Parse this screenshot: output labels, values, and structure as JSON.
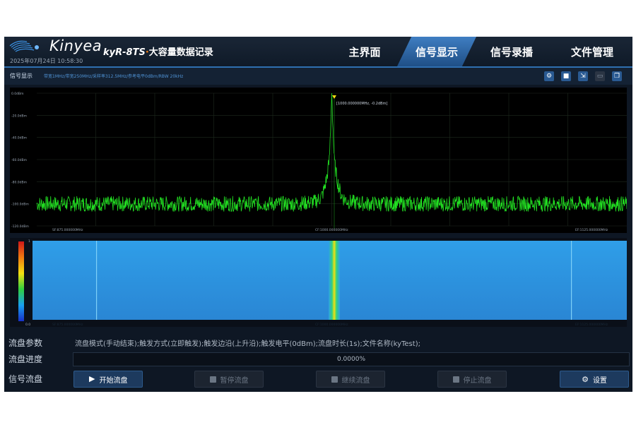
{
  "header": {
    "brand": "Kinyea",
    "datetime": "2025年07月24日 10:58:30",
    "model": "kyR-8TS",
    "product_sep": "·",
    "product_title": "大容量数据记录",
    "tabs": [
      {
        "label": "主界面",
        "active": false
      },
      {
        "label": "信号显示",
        "active": true
      },
      {
        "label": "信号录播",
        "active": false
      },
      {
        "label": "文件管理",
        "active": false
      }
    ]
  },
  "display": {
    "panel_title": "信号显示",
    "params_line": "带宽1MHz/带宽250MHz/采样率312.5MHz/参考电平0dBm/RBW 20kHz",
    "toolbar_icons": [
      "gear-icon",
      "stop-icon",
      "export-icon",
      "window-icon",
      "layers-icon"
    ]
  },
  "spectrum": {
    "y_ticks": [
      "0.0dBm",
      "-20.0dBm",
      "-40.0dBm",
      "-60.0dBm",
      "-80.0dBm",
      "-100.0dBm",
      "-120.0dBm"
    ],
    "marker_label": "[1000.000000MHz, -0.2dBm]",
    "x_labels": [
      "SF:875.000000MHz",
      "CF:1000.000000MHz",
      "EF:1125.000000MHz"
    ]
  },
  "waterfall": {
    "scale_top": "1",
    "scale_bottom": "0.0",
    "x_labels": [
      "SF:875.000000MHz",
      "CF:1000.000000MHz",
      "EF:1125.000000MHz"
    ]
  },
  "chart_data": {
    "type": "line",
    "series": [
      {
        "values": [
          -100,
          -100,
          -100,
          -99,
          -98,
          -95,
          -92,
          -85,
          -75,
          -60,
          0,
          -60,
          -75,
          -85,
          -92,
          -95,
          -98,
          -99,
          -100,
          -100,
          -100
        ]
      }
    ],
    "x": [
      875,
      975,
      985,
      990,
      993,
      995,
      996,
      997,
      998,
      999,
      1000,
      1001,
      1002,
      1003,
      1004,
      1005,
      1007,
      1010,
      1015,
      1025,
      1125
    ],
    "ylim": [
      -120,
      0
    ],
    "xlim": [
      875,
      1125
    ]
  },
  "bottom": {
    "params_label": "流盘参数",
    "params_value": "流盘模式(手动结束);触发方式(立即触发);触发边沿(上升沿);触发电平(0dBm);流盘时长(1s);文件名称(kyTest);",
    "progress_label": "流盘进度",
    "progress_percent": 0,
    "progress_text": "0.0000%",
    "stream_label": "信号流盘",
    "buttons": {
      "start": "开始流盘",
      "pause": "暂停流盘",
      "resume": "继续流盘",
      "stop": "停止流盘",
      "settings": "设置"
    }
  },
  "colors": {
    "accent": "#2f6fb0",
    "spectrum_trace": "#22e022",
    "marker": "#f4e010",
    "background": "#0e1724"
  }
}
